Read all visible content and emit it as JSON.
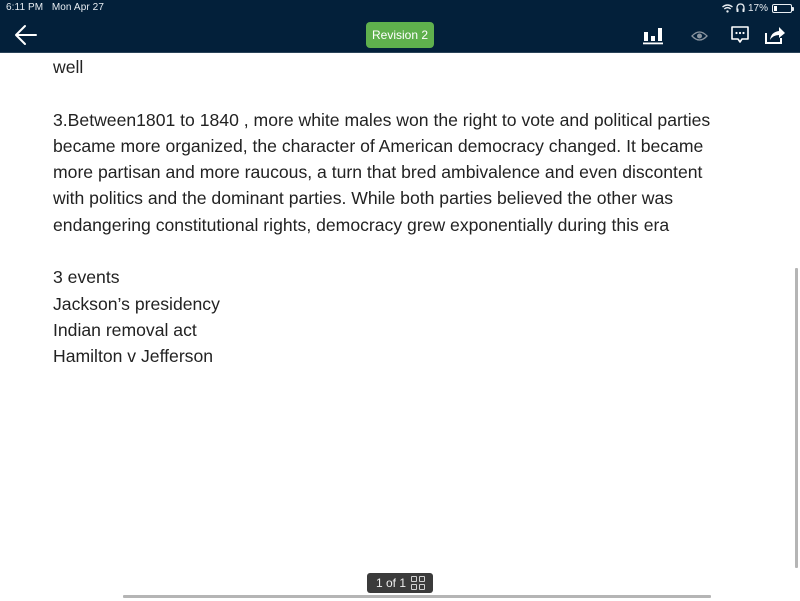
{
  "status_bar": {
    "time": "6:11 PM",
    "date": "Mon Apr 27",
    "battery_percent": "17%"
  },
  "toolbar": {
    "back_icon": "arrow-left-icon",
    "revision_label": "Revision 2",
    "revision_color": "#5fb04d",
    "icons": [
      "bar-chart-icon",
      "eye-icon",
      "comment-icon",
      "share-icon"
    ]
  },
  "document": {
    "lines": [
      "well",
      "",
      "3.Between1801 to 1840 , more white males won the right to vote and political parties",
      "became more organized, the character of American democracy changed. It became",
      "more partisan and more raucous, a turn that bred ambivalence and even discontent",
      "with politics and the dominant parties. While both parties believed the other was",
      "endangering constitutional rights, democracy grew exponentially during this era",
      "",
      "3 events",
      "Jackson’s presidency",
      "Indian removal act",
      "Hamilton v Jefferson"
    ]
  },
  "footer": {
    "page_indicator": "1 of 1",
    "grid_icon": "grid-view-icon"
  }
}
